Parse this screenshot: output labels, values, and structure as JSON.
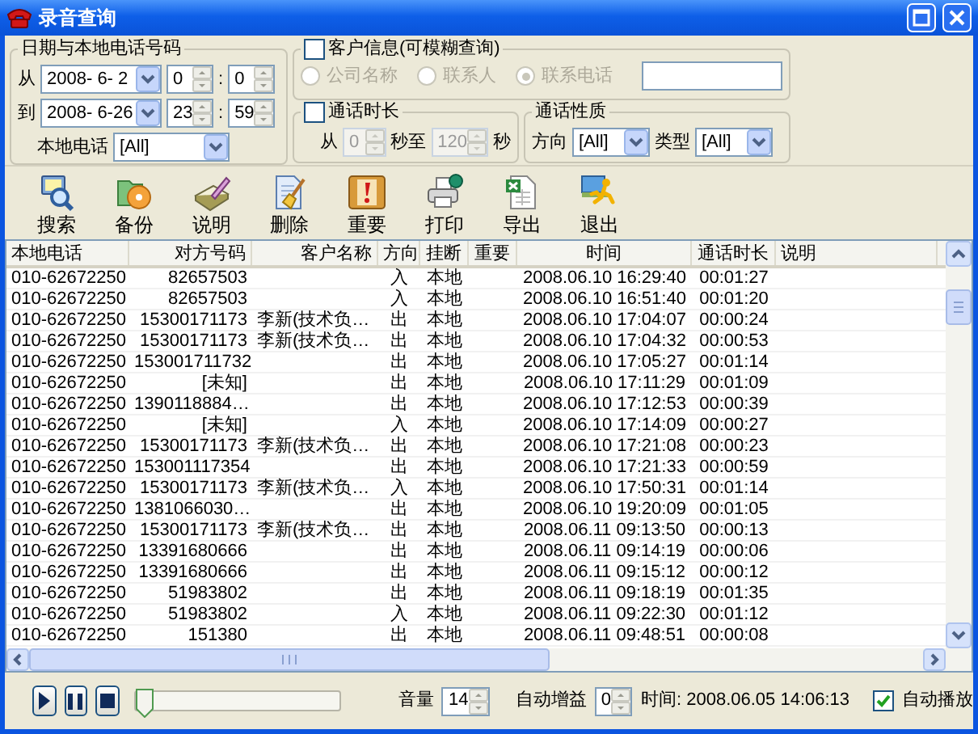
{
  "window": {
    "title": "录音查询"
  },
  "date_group": {
    "title": "日期与本地电话号码",
    "rows": [
      {
        "label": "从",
        "date": "2008- 6- 2",
        "hour": "0",
        "separator": ":",
        "minute": "0"
      },
      {
        "label": "到",
        "date": "2008- 6-26",
        "hour": "23",
        "separator": ":",
        "minute": "59"
      }
    ],
    "local_phone": {
      "label": "本地电话",
      "value": "[All]"
    }
  },
  "customer_group": {
    "title": "客户信息(可模糊查询)",
    "checked": false,
    "disabled": true,
    "radios": [
      {
        "label": "公司名称",
        "selected": false
      },
      {
        "label": "联系人",
        "selected": false
      },
      {
        "label": "联系电话",
        "selected": true
      }
    ]
  },
  "duration_group": {
    "title": "通话时长",
    "checked": false,
    "disabled": true,
    "from_label": "从",
    "from_value": "0",
    "to_label": "秒至",
    "to_value": "120",
    "unit": "秒"
  },
  "type_group": {
    "title": "通话性质",
    "direction_label": "方向",
    "direction_value": "[All]",
    "type_label": "类型",
    "type_value": "[All]"
  },
  "toolbar": [
    {
      "label": "搜索"
    },
    {
      "label": "备份"
    },
    {
      "label": "说明"
    },
    {
      "label": "删除"
    },
    {
      "label": "重要"
    },
    {
      "label": "打印"
    },
    {
      "label": "导出"
    },
    {
      "label": "退出"
    }
  ],
  "table": {
    "columns": [
      "本地电话",
      "对方号码",
      "客户名称",
      "方向",
      "挂断",
      "重要",
      "时间",
      "通话时长",
      "说明"
    ],
    "rows": [
      {
        "local": "010-62672250",
        "remote": "82657503",
        "direction": "入",
        "hangup": "本地",
        "time": "2008.06.10 16:29:40",
        "duration": "00:01:27"
      },
      {
        "local": "010-62672250",
        "remote": "82657503",
        "direction": "入",
        "hangup": "本地",
        "time": "2008.06.10 16:51:40",
        "duration": "00:01:20"
      },
      {
        "local": "010-62672250",
        "remote": "15300171173",
        "customer": "李新(技术负…",
        "direction": "出",
        "hangup": "本地",
        "time": "2008.06.10 17:04:07",
        "duration": "00:00:24"
      },
      {
        "local": "010-62672250",
        "remote": "15300171173",
        "customer": "李新(技术负…",
        "direction": "出",
        "hangup": "本地",
        "time": "2008.06.10 17:04:32",
        "duration": "00:00:53"
      },
      {
        "local": "010-62672250",
        "remote": "153001711732",
        "direction": "出",
        "hangup": "本地",
        "time": "2008.06.10 17:05:27",
        "duration": "00:01:14"
      },
      {
        "local": "010-62672250",
        "remote": "[未知]",
        "direction": "出",
        "hangup": "本地",
        "time": "2008.06.10 17:11:29",
        "duration": "00:01:09"
      },
      {
        "local": "010-62672250",
        "remote": "1390118884…",
        "direction": "出",
        "hangup": "本地",
        "time": "2008.06.10 17:12:53",
        "duration": "00:00:39"
      },
      {
        "local": "010-62672250",
        "remote": "[未知]",
        "direction": "入",
        "hangup": "本地",
        "time": "2008.06.10 17:14:09",
        "duration": "00:00:27"
      },
      {
        "local": "010-62672250",
        "remote": "15300171173",
        "customer": "李新(技术负…",
        "direction": "出",
        "hangup": "本地",
        "time": "2008.06.10 17:21:08",
        "duration": "00:00:23"
      },
      {
        "local": "010-62672250",
        "remote": "153001117354",
        "direction": "出",
        "hangup": "本地",
        "time": "2008.06.10 17:21:33",
        "duration": "00:00:59"
      },
      {
        "local": "010-62672250",
        "remote": "15300171173",
        "customer": "李新(技术负…",
        "direction": "入",
        "hangup": "本地",
        "time": "2008.06.10 17:50:31",
        "duration": "00:01:14"
      },
      {
        "local": "010-62672250",
        "remote": "1381066030…",
        "direction": "出",
        "hangup": "本地",
        "time": "2008.06.10 19:20:09",
        "duration": "00:01:05"
      },
      {
        "local": "010-62672250",
        "remote": "15300171173",
        "customer": "李新(技术负…",
        "direction": "出",
        "hangup": "本地",
        "time": "2008.06.11 09:13:50",
        "duration": "00:00:13"
      },
      {
        "local": "010-62672250",
        "remote": "13391680666",
        "direction": "出",
        "hangup": "本地",
        "time": "2008.06.11 09:14:19",
        "duration": "00:00:06"
      },
      {
        "local": "010-62672250",
        "remote": "13391680666",
        "direction": "出",
        "hangup": "本地",
        "time": "2008.06.11 09:15:12",
        "duration": "00:00:12"
      },
      {
        "local": "010-62672250",
        "remote": "51983802",
        "direction": "出",
        "hangup": "本地",
        "time": "2008.06.11 09:18:19",
        "duration": "00:01:35"
      },
      {
        "local": "010-62672250",
        "remote": "51983802",
        "direction": "入",
        "hangup": "本地",
        "time": "2008.06.11 09:22:30",
        "duration": "00:01:12"
      },
      {
        "local": "010-62672250",
        "remote": "151380",
        "direction": "出",
        "hangup": "本地",
        "time": "2008.06.11 09:48:51",
        "duration": "00:00:08"
      }
    ]
  },
  "player": {
    "level": 0,
    "volume_label": "音量",
    "volume": "14",
    "gain_label": "自动增益",
    "gain": "0",
    "time": "时间: 2008.06.05 14:06:13",
    "autoplay": {
      "label": "自动播放",
      "checked": true
    }
  }
}
